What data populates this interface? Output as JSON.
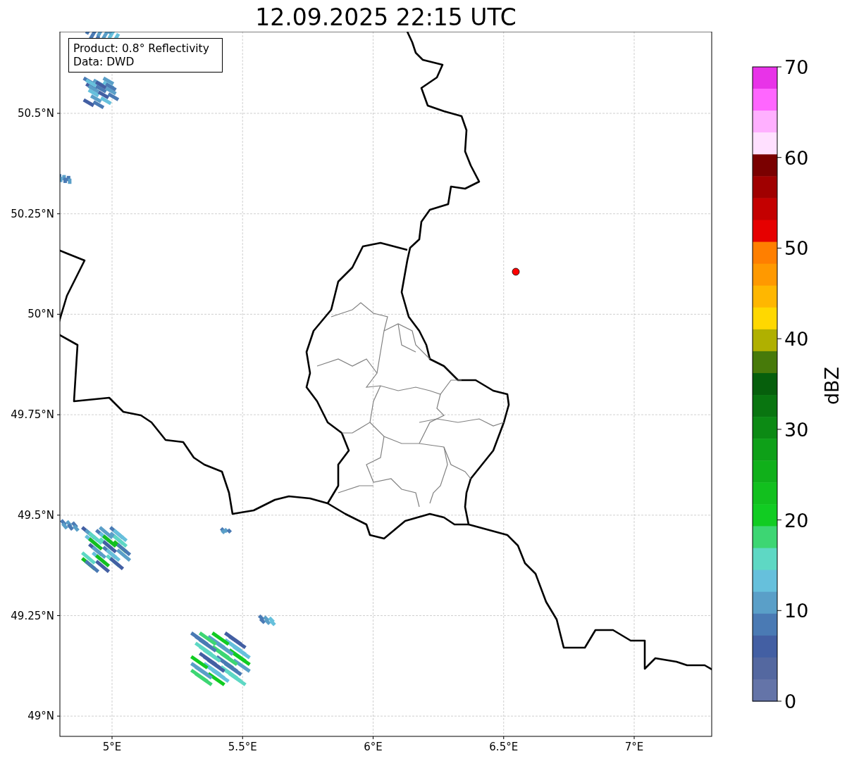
{
  "title": "12.09.2025 22:15 UTC",
  "info_box": {
    "lines": [
      "Product: 0.8° Reflectivity",
      "Data: DWD"
    ]
  },
  "map": {
    "yticks": [
      "50.5°N",
      "50.25°N",
      "50°N",
      "49.75°N",
      "49.5°N",
      "49.25°N",
      "49°N"
    ],
    "xticks": [
      "5°E",
      "5.5°E",
      "6°E",
      "6.5°E",
      "7°E"
    ],
    "marker": {
      "color": "#ff0000"
    }
  },
  "colorbar": {
    "label": "dBZ",
    "ticks": [
      "70",
      "60",
      "50",
      "40",
      "30",
      "20",
      "10",
      "0"
    ],
    "bands": [
      {
        "color": "#e833e8"
      },
      {
        "color": "#ff66ff"
      },
      {
        "color": "#ffb0ff"
      },
      {
        "color": "#ffe0ff"
      },
      {
        "color": "#7a0000"
      },
      {
        "color": "#a00000"
      },
      {
        "color": "#c40000"
      },
      {
        "color": "#e60000"
      },
      {
        "color": "#ff7f00"
      },
      {
        "color": "#ff9900"
      },
      {
        "color": "#ffb700"
      },
      {
        "color": "#ffd800"
      },
      {
        "color": "#b0b000"
      },
      {
        "color": "#477a0a"
      },
      {
        "color": "#065f0c"
      },
      {
        "color": "#097510"
      },
      {
        "color": "#0c8a14"
      },
      {
        "color": "#0ea018"
      },
      {
        "color": "#10b01a"
      },
      {
        "color": "#12c01e"
      },
      {
        "color": "#11cc22"
      },
      {
        "color": "#3dd673"
      },
      {
        "color": "#5ed8c4"
      },
      {
        "color": "#66c0dc"
      },
      {
        "color": "#5a9fc8"
      },
      {
        "color": "#4a7ab4"
      },
      {
        "color": "#435fa3"
      },
      {
        "color": "#5468a0"
      },
      {
        "color": "#6474a8"
      }
    ]
  }
}
